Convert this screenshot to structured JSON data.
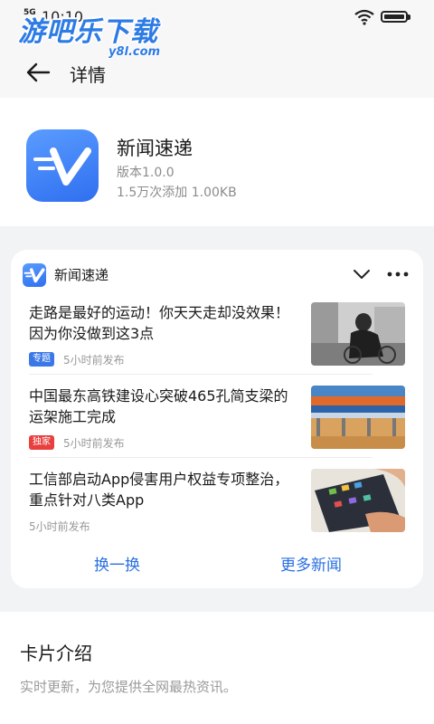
{
  "status_bar": {
    "network": "5G",
    "time": "10:10"
  },
  "watermark": {
    "main": "游吧乐下载",
    "sub": "y8l.com"
  },
  "header": {
    "title": "详情"
  },
  "app": {
    "name": "新闻速递",
    "version": "版本1.0.0",
    "stats": "1.5万次添加 1.00KB"
  },
  "card": {
    "title": "新闻速递",
    "news": [
      {
        "title": "走路是最好的运动！你天天走却没效果！因为你没做到这3点",
        "tag": "专题",
        "time": "5小时前发布"
      },
      {
        "title": "中国最东高铁建设心突破465孔简支梁的运架施工完成",
        "tag": "独家",
        "time": "5小时前发布"
      },
      {
        "title": "工信部启动App侵害用户权益专项整治，重点针对八类App",
        "time": "5小时前发布"
      }
    ],
    "buttons": {
      "refresh": "换一换",
      "more": "更多新闻"
    }
  },
  "intro": {
    "heading": "卡片介绍",
    "text": "实时更新，为您提供全网最热资讯。"
  },
  "colors": {
    "accent": "#2a6fe0",
    "tag_blue": "#3b78e7",
    "tag_red": "#e8403f"
  }
}
